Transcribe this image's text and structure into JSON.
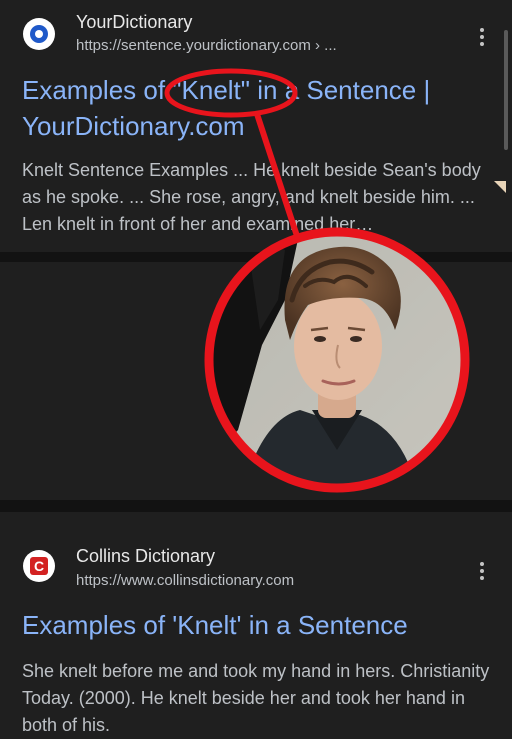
{
  "results": [
    {
      "site_name": "YourDictionary",
      "url": "https://sentence.yourdictionary.com › ...",
      "title": "Examples of \"Knelt\" in a Sentence | YourDictionary.com",
      "snippet": "Knelt Sentence Examples ... He knelt beside Sean's body as he spoke. ... She rose, angry, and knelt beside him. ... Len knelt in front of her and examined her…",
      "favicon": "yourdictionary-icon"
    },
    {
      "site_name": "Collins Dictionary",
      "url": "https://www.collinsdictionary.com",
      "title": "Examples of 'Knelt' in a Sentence",
      "snippet": "She knelt before me and took my hand in hers. Christianity Today. (2000). He knelt beside her and took her hand in both of his.",
      "favicon": "collins-icon",
      "favicon_letter": "C"
    }
  ],
  "overlay": {
    "highlight_color": "#e8141c",
    "photo": "cropped photo of a young man with curly brown hair in a dark collared shirt"
  }
}
